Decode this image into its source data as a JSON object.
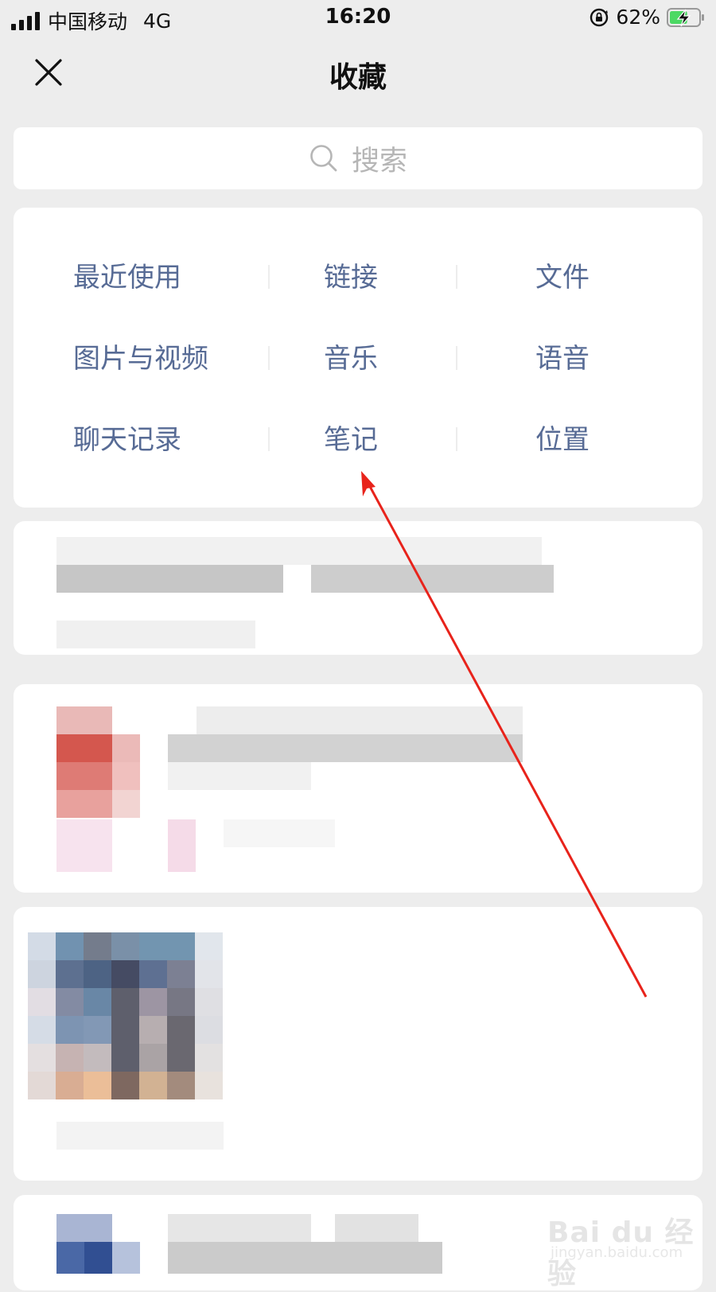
{
  "status_bar": {
    "carrier": "中国移动",
    "network": "4G",
    "time": "16:20",
    "battery_percent": "62%",
    "battery_level": 0.62
  },
  "nav": {
    "title": "收藏",
    "close_icon": "close-icon"
  },
  "search": {
    "placeholder": "搜索",
    "icon": "search-icon"
  },
  "categories": {
    "rows": [
      [
        "最近使用",
        "链接",
        "文件"
      ],
      [
        "图片与视频",
        "音乐",
        "语音"
      ],
      [
        "聊天记录",
        "笔记",
        "位置"
      ]
    ],
    "label_color": "#576b95"
  },
  "watermark": {
    "brand": "Bai du 经验",
    "url": "jingyan.baidu.com"
  },
  "colors": {
    "background": "#ededed",
    "card": "#ffffff",
    "annotation_arrow": "#e8231b"
  }
}
